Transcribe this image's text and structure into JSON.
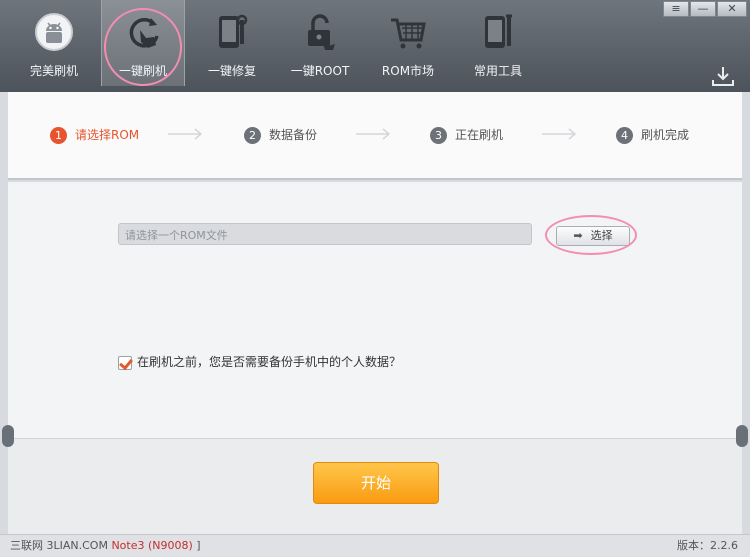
{
  "toolbar": {
    "items": [
      {
        "label": "完美刷机",
        "icon": "android-icon"
      },
      {
        "label": "一键刷机",
        "icon": "refresh-hand-icon",
        "active": true
      },
      {
        "label": "一键修复",
        "icon": "phone-wrench-icon"
      },
      {
        "label": "一键ROOT",
        "icon": "unlock-icon"
      },
      {
        "label": "ROM市场",
        "icon": "cart-icon"
      },
      {
        "label": "常用工具",
        "icon": "tools-icon"
      }
    ],
    "window_controls": {
      "menu": "≡",
      "minimize": "—",
      "close": "✕"
    }
  },
  "steps": [
    {
      "num": "1",
      "label": "请选择ROM",
      "current": true
    },
    {
      "num": "2",
      "label": "数据备份"
    },
    {
      "num": "3",
      "label": "正在刷机"
    },
    {
      "num": "4",
      "label": "刷机完成"
    }
  ],
  "rom": {
    "placeholder": "请选择一个ROM文件",
    "choose_label": "选择",
    "arrow": "➡"
  },
  "backup_option": {
    "label": "在刷机之前，您是否需要备份手机中的个人数据？",
    "checked": true
  },
  "start_label": "开始",
  "status": {
    "device_prefix": "三联网 3LIAN.COM",
    "device_model": "Note3 (N9008)",
    "device_suffix": " ]",
    "version": "版本：2.2.6"
  },
  "colors": {
    "accent": "#e8542d",
    "start": "#f9a81a",
    "ring": "#f48db0"
  }
}
